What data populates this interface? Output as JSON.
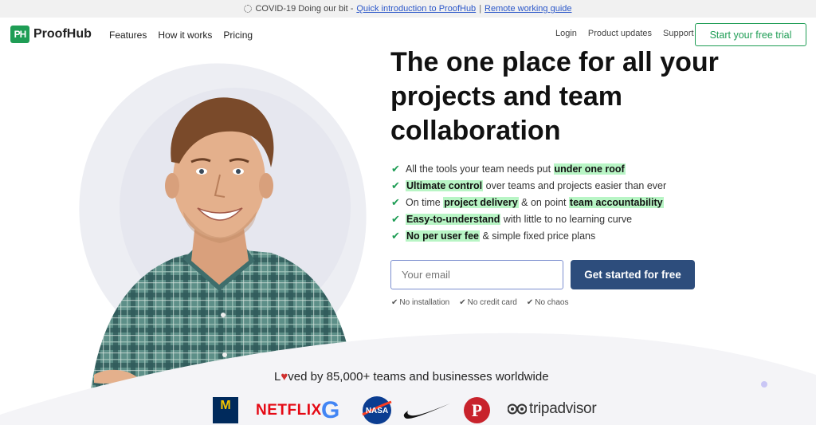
{
  "announcement": {
    "text": "COVID-19 Doing our bit - ",
    "link1": "Quick introduction to ProofHub",
    "separator": "|",
    "link2": "Remote working guide"
  },
  "nav": {
    "logo_mark": "PH",
    "logo_text": "ProofHub",
    "left_items": [
      "Features",
      "How it works",
      "Pricing"
    ],
    "right_items": [
      "Login",
      "Product updates",
      "Support"
    ],
    "trial_button": "Start your free trial"
  },
  "hero": {
    "headline": "The one place for all your projects and team collaboration",
    "features": [
      {
        "parts": [
          {
            "t": "All the tools your team needs put ",
            "h": false
          },
          {
            "t": "under one roof",
            "h": true
          }
        ]
      },
      {
        "parts": [
          {
            "t": "Ultimate control",
            "h": true
          },
          {
            "t": " over teams and projects easier than ever",
            "h": false
          }
        ]
      },
      {
        "parts": [
          {
            "t": "On time ",
            "h": false
          },
          {
            "t": "project delivery",
            "h": true
          },
          {
            "t": " & on point ",
            "h": false
          },
          {
            "t": "team accountability",
            "h": true
          }
        ]
      },
      {
        "parts": [
          {
            "t": "Easy-to-understand",
            "h": true
          },
          {
            "t": " with little to no learning curve",
            "h": false
          }
        ]
      },
      {
        "parts": [
          {
            "t": "No per user fee",
            "h": true
          },
          {
            "t": " & simple fixed price plans",
            "h": false
          }
        ]
      }
    ],
    "email_placeholder": "Your email",
    "cta_button": "Get started for free",
    "perks": [
      "No installation",
      "No credit card",
      "No chaos"
    ]
  },
  "social_proof": {
    "loved_prefix": "L",
    "loved_suffix": "ved by 85,000+ teams and businesses worldwide",
    "logos": {
      "michigan": "M",
      "netflix": "NETFLIX",
      "google": "G",
      "nasa": "NASA",
      "pinterest": "P",
      "tripadvisor": "tripadvisor"
    }
  },
  "colors": {
    "brand_green": "#1f9d55",
    "cta_blue": "#2d4d7c",
    "highlight": "#b8f5c5"
  }
}
